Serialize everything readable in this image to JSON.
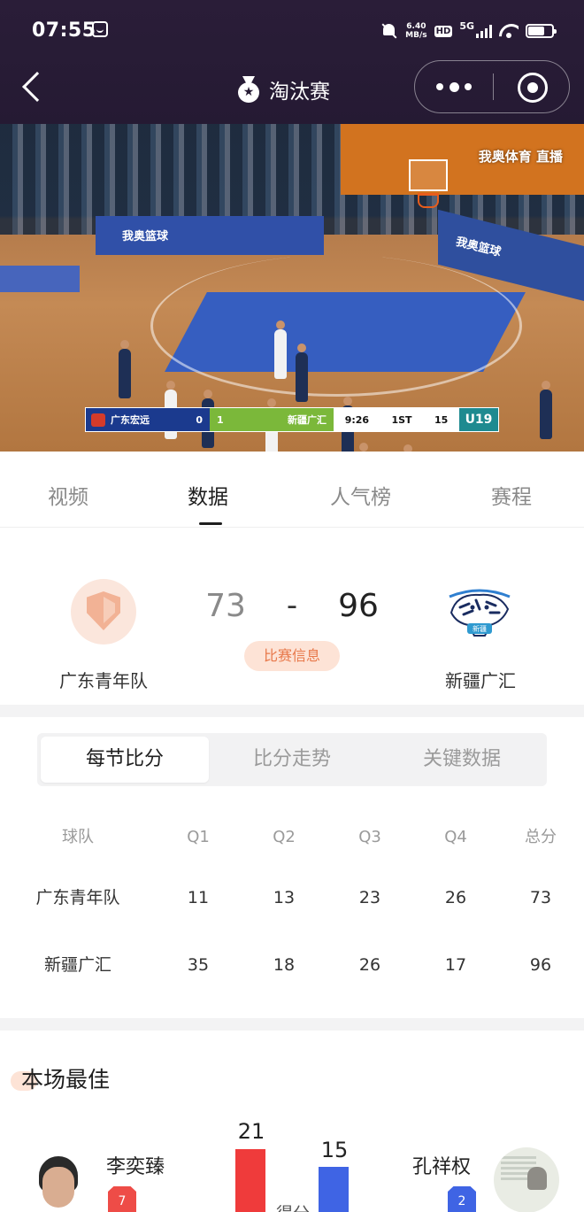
{
  "status_bar": {
    "time": "07:55",
    "net_speed_value": "6.40",
    "net_speed_unit": "MB/s",
    "hd_label": "HD",
    "network_label": "5G"
  },
  "header": {
    "title": "淘汰赛",
    "title_icon": "medal-icon"
  },
  "video": {
    "watermark": "我奥体育 直播",
    "court_board_left": "我奥篮球",
    "court_board_right": "我奥篮球",
    "scorebug": {
      "home_team": "广东宏远",
      "home_score": "0",
      "away_score": "1",
      "away_team": "新疆广汇",
      "clock": "9:26",
      "period": "1ST",
      "shot_clock": "15",
      "tag": "U19"
    }
  },
  "tabs": [
    {
      "label": "视频",
      "active": false
    },
    {
      "label": "数据",
      "active": true
    },
    {
      "label": "人气榜",
      "active": false
    },
    {
      "label": "赛程",
      "active": false
    }
  ],
  "match": {
    "home_team": "广东青年队",
    "away_team": "新疆广汇",
    "home_score": "73",
    "separator": "-",
    "away_score": "96",
    "info_button": "比赛信息",
    "away_logo_text": "新疆"
  },
  "segmented": [
    {
      "label": "每节比分",
      "active": true
    },
    {
      "label": "比分走势",
      "active": false
    },
    {
      "label": "关键数据",
      "active": false
    }
  ],
  "quarter_table": {
    "headers": [
      "球队",
      "Q1",
      "Q2",
      "Q3",
      "Q4",
      "总分"
    ],
    "rows": [
      {
        "team": "广东青年队",
        "q1": "11",
        "q2": "13",
        "q3": "23",
        "q4": "26",
        "total": "73"
      },
      {
        "team": "新疆广汇",
        "q1": "35",
        "q2": "18",
        "q3": "26",
        "q4": "17",
        "total": "96"
      }
    ]
  },
  "mvp": {
    "title": "本场最佳",
    "stat_label": "得分",
    "left_player": {
      "name": "李奕臻",
      "number": "7",
      "value": 21,
      "value_label": "21",
      "color": "#ef3b3b"
    },
    "right_player": {
      "name": "孔祥权",
      "number": "2",
      "value": 15,
      "value_label": "15",
      "color": "#3f64e4"
    }
  },
  "colors": {
    "header_bg": "#251a33",
    "accent": "#e8784a",
    "accent_bg": "#fde3d6"
  }
}
